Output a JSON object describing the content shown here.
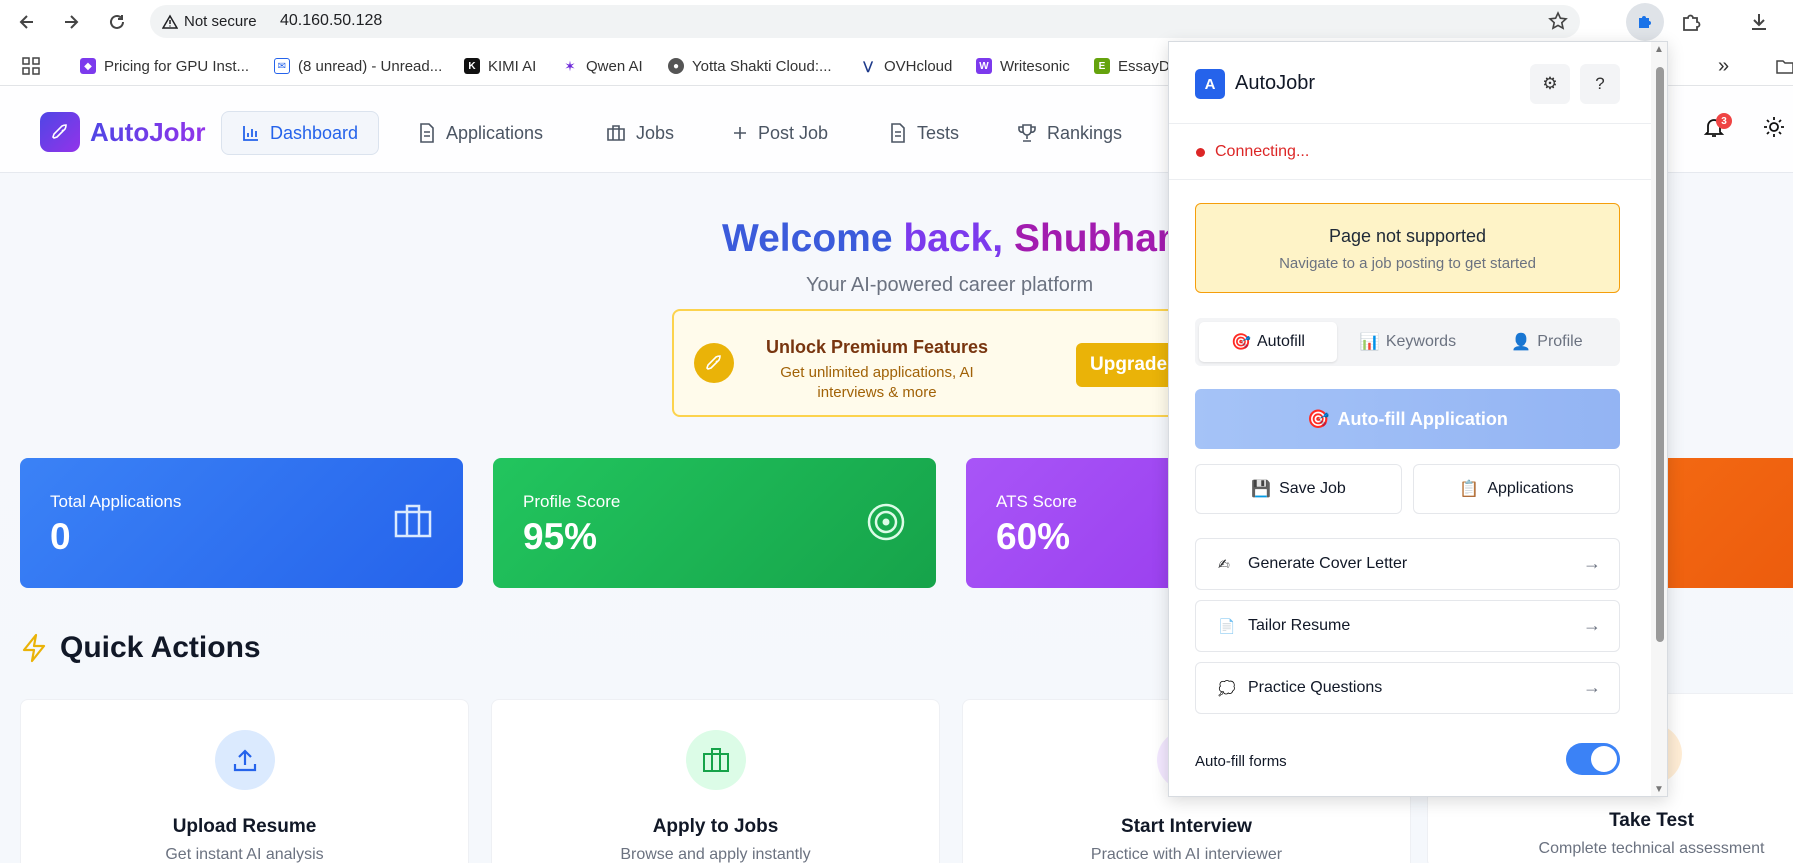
{
  "browser": {
    "not_secure_label": "Not secure",
    "url": "40.160.50.128",
    "bookmarks": [
      {
        "label": "Pricing for GPU Inst...",
        "icon": "cube-icon",
        "color": "#7c3aed"
      },
      {
        "label": "(8 unread) - Unread...",
        "icon": "mail-icon",
        "color": "#2563eb"
      },
      {
        "label": "KIMI AI",
        "icon": "kimi-icon",
        "color": "#111111"
      },
      {
        "label": "Qwen AI",
        "icon": "qwen-icon",
        "color": "#6d28d9"
      },
      {
        "label": "Yotta Shakti Cloud:...",
        "icon": "globe-icon",
        "color": "#555555"
      },
      {
        "label": "OVHcloud",
        "icon": "ovh-icon",
        "color": "#1e3a8a"
      },
      {
        "label": "Writesonic",
        "icon": "writesonic-icon",
        "color": "#7c3aed"
      },
      {
        "label": "EssayDo",
        "icon": "essay-icon",
        "color": "#65a30d"
      }
    ],
    "more_bookmarks": "»"
  },
  "app": {
    "brand": "AutoJobr",
    "nav": [
      {
        "label": "Dashboard",
        "icon": "chart-icon",
        "active": true
      },
      {
        "label": "Applications",
        "icon": "document-icon",
        "active": false
      },
      {
        "label": "Jobs",
        "icon": "briefcase-icon",
        "active": false
      },
      {
        "label": "Post Job",
        "icon": "plus-icon",
        "active": false
      },
      {
        "label": "Tests",
        "icon": "document-icon",
        "active": false
      },
      {
        "label": "Rankings",
        "icon": "trophy-icon",
        "active": false
      }
    ],
    "notification_count": "3"
  },
  "welcome": {
    "part1": "Welcome",
    "part2": "back,",
    "part3": "Shubham",
    "subtitle": "Your AI-powered career platform"
  },
  "premium": {
    "title": "Unlock Premium Features",
    "subtitle": "Get unlimited applications, AI interviews & more",
    "button": "Upgrade"
  },
  "stats": [
    {
      "label": "Total Applications",
      "value": "0",
      "color_from": "#3b82f6",
      "color_to": "#2563eb",
      "icon": "briefcase-icon"
    },
    {
      "label": "Profile Score",
      "value": "95%",
      "color_from": "#22c55e",
      "color_to": "#16a34a",
      "icon": "target-icon"
    },
    {
      "label": "ATS Score",
      "value": "60%",
      "color_from": "#a855f7",
      "color_to": "#9333ea",
      "icon": "chart-icon"
    },
    {
      "label": "",
      "value": "",
      "color_from": "#f97316",
      "color_to": "#ea580c",
      "icon": ""
    }
  ],
  "quick_actions": {
    "title": "Quick Actions",
    "items": [
      {
        "name": "Upload Resume",
        "desc": "Get instant AI analysis",
        "icon": "upload-icon",
        "bg": "#dbeafe",
        "fg": "#2563eb"
      },
      {
        "name": "Apply to Jobs",
        "desc": "Browse and apply instantly",
        "icon": "briefcase-icon",
        "bg": "#dcfce7",
        "fg": "#16a34a"
      },
      {
        "name": "Start Interview",
        "desc": "Practice with AI interviewer",
        "icon": "mic-icon",
        "bg": "#f3e8ff",
        "fg": "#9333ea"
      },
      {
        "name": "Take Test",
        "desc": "Complete technical assessment",
        "icon": "test-icon",
        "bg": "#ffedd5",
        "fg": "#ea580c"
      }
    ]
  },
  "popup": {
    "logo": "A",
    "title": "AutoJobr",
    "settings_icon": "⚙",
    "help_label": "?",
    "status": "Connecting...",
    "notice_title": "Page not supported",
    "notice_sub": "Navigate to a job posting to get started",
    "tabs": [
      {
        "label": "Autofill",
        "emoji": "🎯",
        "active": true
      },
      {
        "label": "Keywords",
        "emoji": "📊",
        "active": false
      },
      {
        "label": "Profile",
        "emoji": "👤",
        "active": false
      }
    ],
    "primary_emoji": "🎯",
    "primary": "Auto-fill Application",
    "save_emoji": "💾",
    "save_job": "Save Job",
    "apps_emoji": "📋",
    "applications": "Applications",
    "rows": [
      {
        "emoji": "✍",
        "label": "Generate Cover Letter"
      },
      {
        "emoji": "📄",
        "label": "Tailor Resume"
      },
      {
        "emoji": "💭",
        "label": "Practice Questions"
      }
    ],
    "arrow": "→",
    "toggle_label": "Auto-fill forms",
    "toggle_on": true
  }
}
